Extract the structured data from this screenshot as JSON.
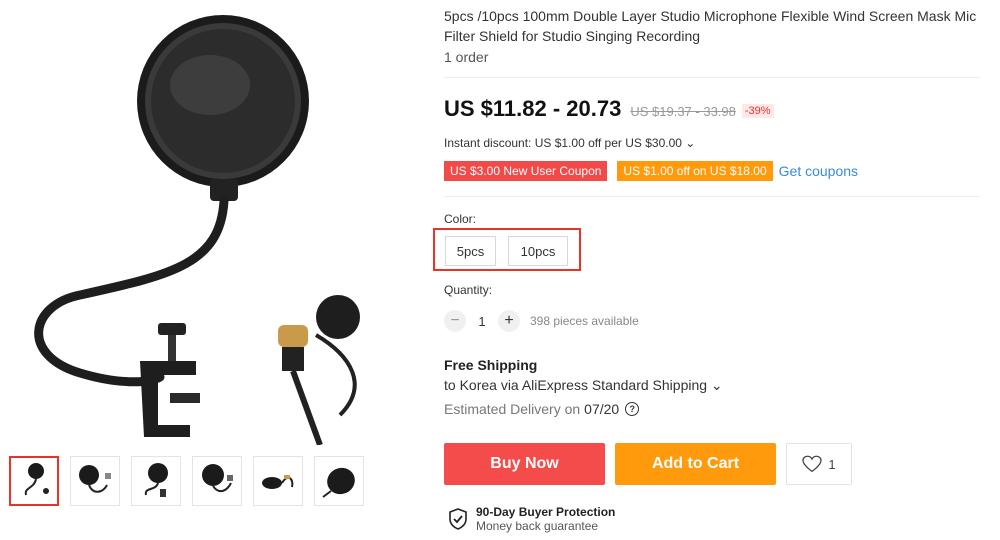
{
  "product": {
    "title": "5pcs /10pcs 100mm Double Layer Studio Microphone Flexible Wind Screen Mask Mic Filter Shield for Studio Singing Recording",
    "orders": "1 order"
  },
  "price": {
    "current": "US $11.82 - 20.73",
    "original": "US $19.37 - 33.98",
    "discount": "-39%"
  },
  "instant_discount": "Instant discount: US $1.00 off per US $30.00 ⌄",
  "coupons": {
    "items": [
      "US $3.00 New User Coupon",
      "US $1.00 off on US $18.00"
    ],
    "get_label": "Get coupons"
  },
  "color": {
    "label": "Color:",
    "options": [
      "5pcs",
      "10pcs"
    ]
  },
  "quantity": {
    "label": "Quantity:",
    "minus": "−",
    "value": "1",
    "plus": "+",
    "available": "398 pieces available"
  },
  "shipping": {
    "title": "Free Shipping",
    "to": "to Korea via AliExpress Standard Shipping ⌄",
    "delivery_label": "Estimated Delivery on",
    "delivery_date": "07/20",
    "help_icon": "?"
  },
  "actions": {
    "buy": "Buy Now",
    "cart": "Add to Cart",
    "wishlist_count": "1"
  },
  "protection": {
    "title": "90-Day Buyer Protection",
    "subtitle": "Money back guarantee"
  },
  "colors": {
    "accent_red": "#f44b4b",
    "accent_orange": "#ff9a0d",
    "link_blue": "#3a8bd1"
  }
}
